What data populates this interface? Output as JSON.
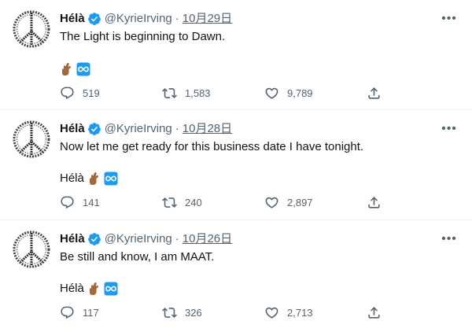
{
  "colors": {
    "verified": "#1d9bf0",
    "muted": "#536471",
    "text": "#0f1419",
    "divider": "#eff3f4"
  },
  "tweets": [
    {
      "name": "Hélà",
      "handle": "@KyrieIrving",
      "separator": "·",
      "date": "10月29日",
      "text": "The Light is beginning to Dawn.",
      "signature": "",
      "icons": [
        "crossed-fingers-emoji-icon",
        "infinity-emoji-icon"
      ],
      "replies": "519",
      "retweets": "1,583",
      "likes": "9,789"
    },
    {
      "name": "Hélà",
      "handle": "@KyrieIrving",
      "separator": "·",
      "date": "10月28日",
      "text": "Now let me get ready for this business date I have tonight.",
      "signature": "Hélà",
      "icons": [
        "crossed-fingers-emoji-icon",
        "infinity-emoji-icon"
      ],
      "replies": "141",
      "retweets": "240",
      "likes": "2,897"
    },
    {
      "name": "Hélà",
      "handle": "@KyrieIrving",
      "separator": "·",
      "date": "10月26日",
      "text": "Be still and know, I am MAAT.",
      "signature": "Hélà",
      "icons": [
        "crossed-fingers-emoji-icon",
        "infinity-emoji-icon"
      ],
      "replies": "117",
      "retweets": "326",
      "likes": "2,713"
    }
  ]
}
